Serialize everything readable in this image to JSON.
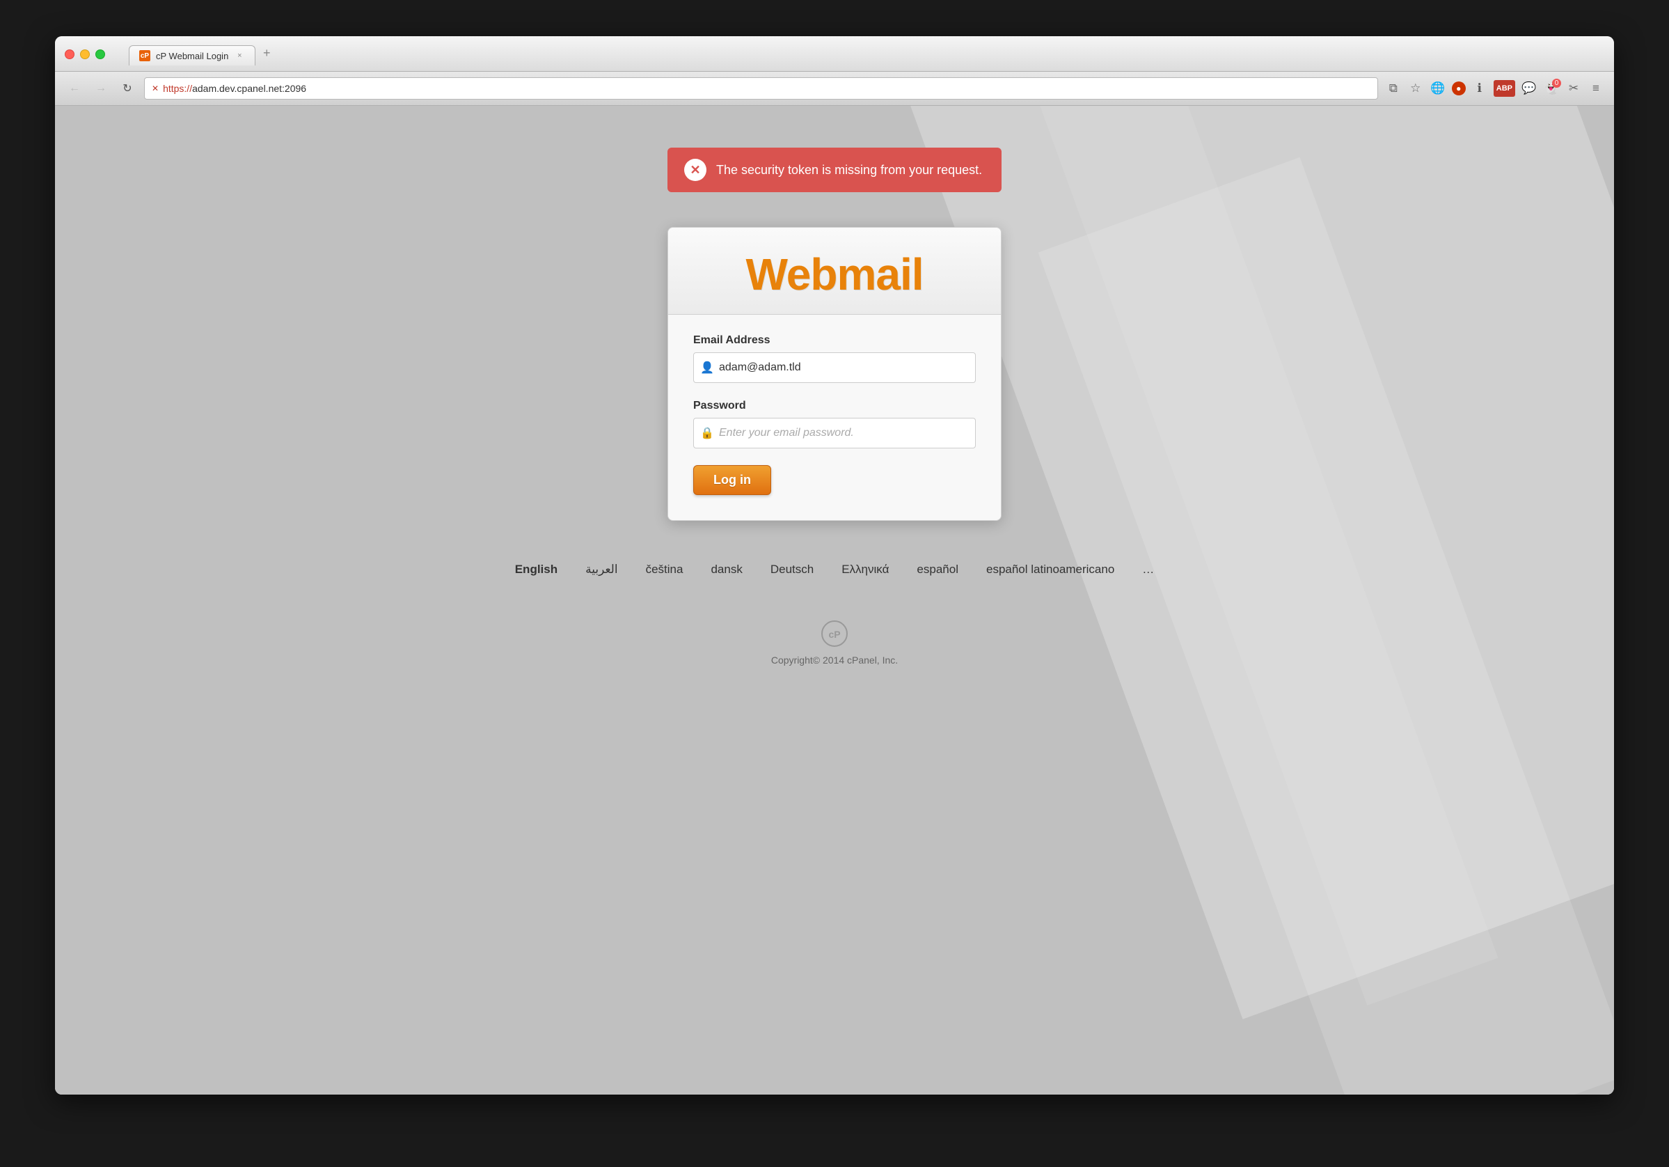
{
  "browser": {
    "tab_title": "cP Webmail Login",
    "tab_favicon": "cP",
    "tab_close": "×",
    "nav": {
      "back": "←",
      "forward": "→",
      "reload": "↻"
    },
    "address_bar": {
      "ssl_badge": "✕",
      "protocol": "https://",
      "domain": "adam.dev.cpanel.net:2096"
    },
    "toolbar_icons": [
      "⧉",
      "☆",
      "🎤",
      "🔴",
      "ℹ",
      "ABP",
      "💬",
      "👻",
      "✂",
      "≡"
    ]
  },
  "error": {
    "message": "The security token is missing from your request."
  },
  "login": {
    "title": "Webmail",
    "email_label": "Email Address",
    "email_value": "adam@adam.tld",
    "email_placeholder": "adam@adam.tld",
    "password_label": "Password",
    "password_placeholder": "Enter your email password.",
    "login_button": "Log in"
  },
  "languages": [
    {
      "code": "en",
      "label": "English",
      "active": true
    },
    {
      "code": "ar",
      "label": "العربية",
      "active": false
    },
    {
      "code": "cs",
      "label": "čeština",
      "active": false
    },
    {
      "code": "da",
      "label": "dansk",
      "active": false
    },
    {
      "code": "de",
      "label": "Deutsch",
      "active": false
    },
    {
      "code": "el",
      "label": "Ελληνικά",
      "active": false
    },
    {
      "code": "es",
      "label": "español",
      "active": false
    },
    {
      "code": "es_la",
      "label": "español latinoamericano",
      "active": false
    },
    {
      "code": "more",
      "label": "…",
      "active": false
    }
  ],
  "footer": {
    "copyright": "Copyright© 2014 cPanel, Inc."
  },
  "colors": {
    "brand_orange": "#e8820a",
    "error_red": "#d9534f"
  }
}
